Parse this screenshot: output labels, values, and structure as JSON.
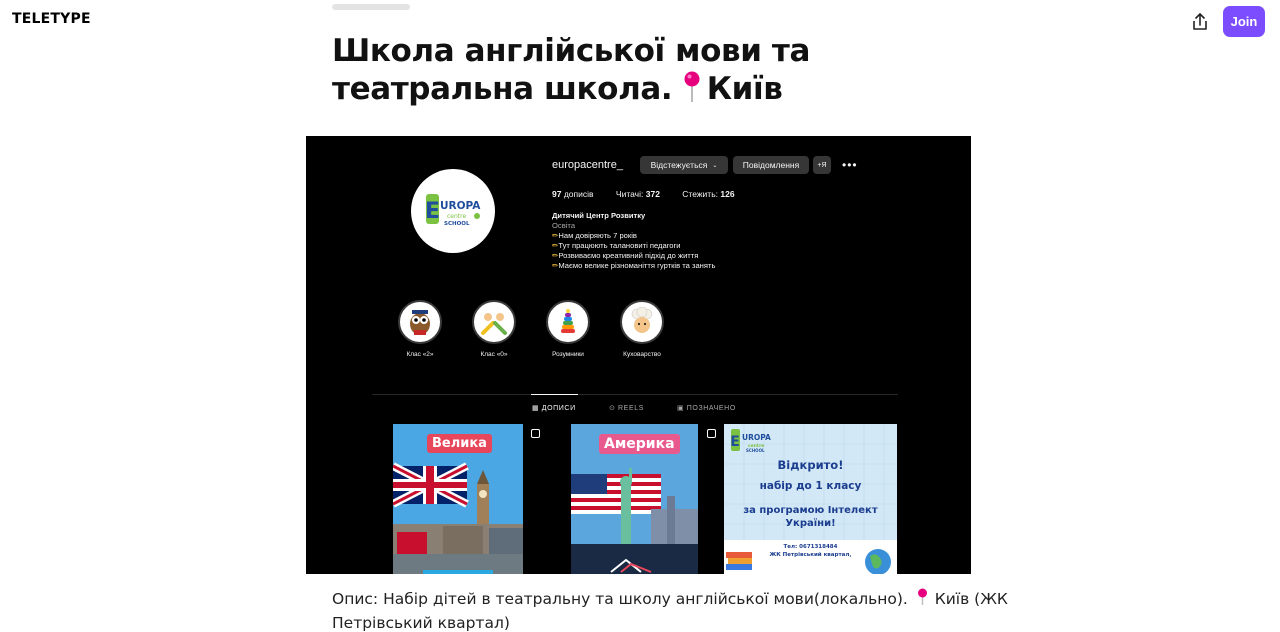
{
  "header": {
    "logo": "TELETYPE",
    "join_label": "Join"
  },
  "article": {
    "title_line1": "Школа англійської мови та",
    "title_line2": "театральна школа.",
    "title_city": "Київ",
    "caption_line1": "Опис: Набір дітей в театральну та школу англійської мови(локально).",
    "caption_city": "Київ (ЖК",
    "caption_line2": "Петрівський квартал)"
  },
  "instagram": {
    "username": "europacentre_",
    "following_label": "Відстежується",
    "message_label": "Повідомлення",
    "add_label": "+Я",
    "posts_count": "97",
    "posts_label": "дописів",
    "followers_label": "Читачі:",
    "followers_count": "372",
    "following_stat_label": "Стежить:",
    "following_count": "126",
    "avatar_text": {
      "e": "E",
      "top": "UROPA",
      "mid": "centre",
      "bot": "SCHOOL"
    },
    "bio": {
      "name": "Дитячий Центр Розвитку",
      "category": "Освіта",
      "lines": [
        "Нам довіряють 7 років",
        "Тут працюють талановиті педагоги",
        "Розвиваємо креативний підхід до життя",
        "Маємо велике різноманіття гуртків та занять"
      ]
    },
    "highlights": [
      {
        "label": "Клас «2»",
        "icon": "owl-icon"
      },
      {
        "label": "Клас «0»",
        "icon": "kids-icon"
      },
      {
        "label": "Розумники",
        "icon": "pyramid-toy-icon"
      },
      {
        "label": "Куховарство",
        "icon": "chef-icon"
      }
    ],
    "tabs": {
      "posts": "ДОПИСИ",
      "reels": "REELS",
      "tagged": "ПОЗНАЧЕНО"
    },
    "posts": [
      {
        "label": "Велика"
      },
      {
        "label": "Америка"
      },
      {
        "line1": "Відкрито!",
        "line2": "набір до 1 класу",
        "line3": "за програмою Інтелект України!",
        "phone": "Тел: 0671318484",
        "address": "ЖК Петрівський квартал,"
      }
    ],
    "colors": {
      "bg": "#000000",
      "button": "#363636",
      "label_red": "#e8465a"
    }
  },
  "colors": {
    "join": "#7c4dff",
    "pin": "#e6007e"
  }
}
